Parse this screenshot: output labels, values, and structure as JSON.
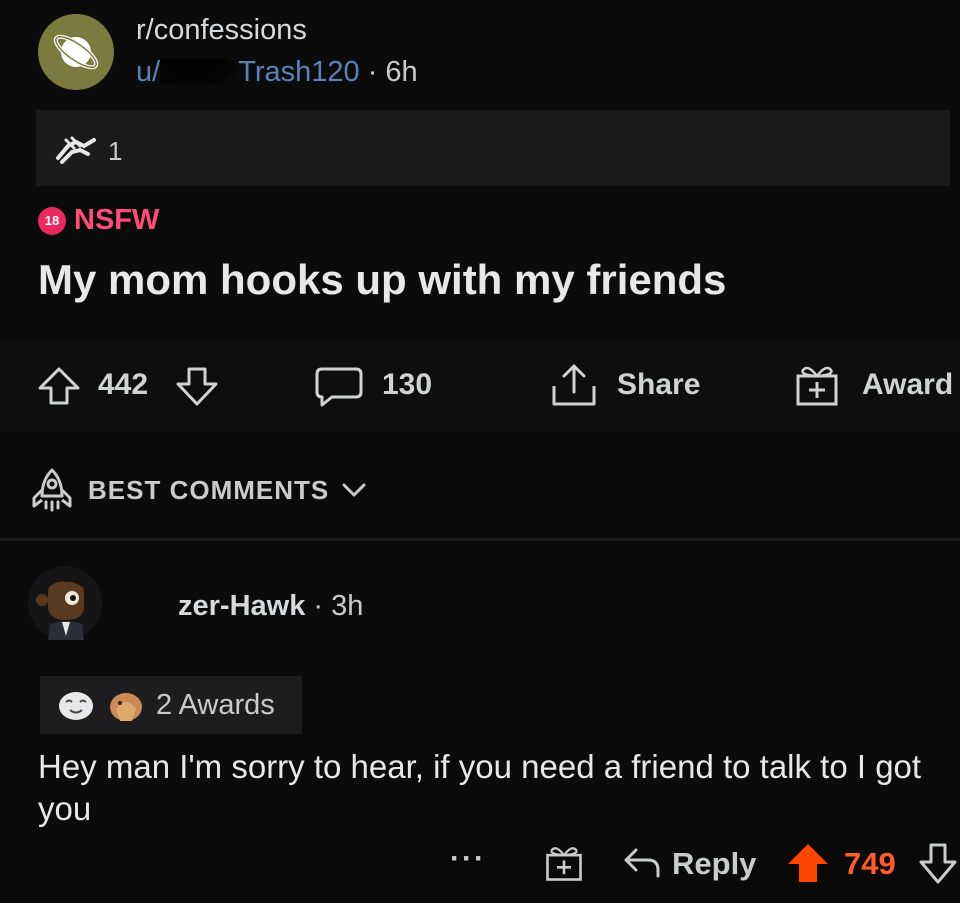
{
  "post": {
    "subreddit": "r/confessions",
    "user_prefix": "u/",
    "username": "Trash120",
    "separator": "·",
    "age": "6h",
    "award_count": "1",
    "nsfw_badge": "18",
    "nsfw_label": "NSFW",
    "title": "My mom hooks up with my friends"
  },
  "actions": {
    "upvotes": "442",
    "comments": "130",
    "share_label": "Share",
    "award_label": "Award"
  },
  "sort": {
    "label": "BEST COMMENTS"
  },
  "comment": {
    "author": "zer-Hawk",
    "separator": "·",
    "age": "3h",
    "awards_label": "2 Awards",
    "body": "Hey man I'm sorry to hear, if you need a friend to talk to I got you",
    "more_label": "···",
    "reply_label": "Reply",
    "score": "749"
  },
  "colors": {
    "accent_upvote": "#ff4500",
    "nsfw": "#e8295f",
    "username_link": "#5b82b6"
  },
  "icons": [
    "planet-icon",
    "helping-hand-award-icon",
    "upvote-icon",
    "downvote-icon",
    "comment-icon",
    "share-icon",
    "gift-icon",
    "rocket-icon",
    "chevron-down-icon",
    "more-icon",
    "reply-icon"
  ]
}
